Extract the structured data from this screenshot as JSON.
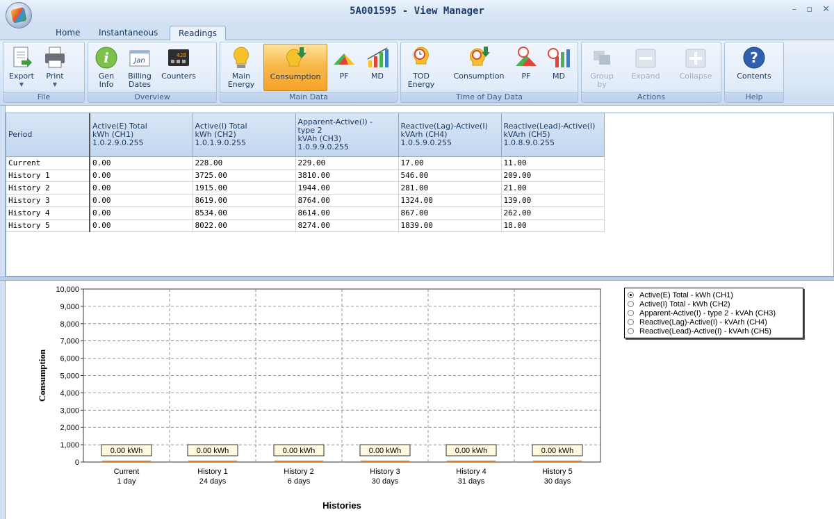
{
  "window": {
    "title": "5A001595 - View Manager",
    "min": "–",
    "max": "▫",
    "close": "✕"
  },
  "tabs": [
    {
      "label": "Home"
    },
    {
      "label": "Instantaneous"
    },
    {
      "label": "Readings"
    }
  ],
  "ribbon": {
    "file": {
      "label": "File",
      "export": "Export",
      "print": "Print"
    },
    "overview": {
      "label": "Overview",
      "gen": "Gen\nInfo",
      "billing": "Billing\nDates",
      "counters": "Counters",
      "billing_icon_text": "Jan",
      "counters_icon_text": "428"
    },
    "main_data": {
      "label": "Main Data",
      "energy": "Main\nEnergy",
      "consumption": "Consumption",
      "pf": "PF",
      "md": "MD"
    },
    "tod": {
      "label": "Time of Day Data",
      "energy": "TOD\nEnergy",
      "consumption": "Consumption",
      "pf": "PF",
      "md": "MD"
    },
    "actions": {
      "label": "Actions",
      "group": "Group\nby",
      "expand": "Expand",
      "collapse": "Collapse"
    },
    "help": {
      "label": "Help",
      "contents": "Contents"
    }
  },
  "table": {
    "headers": [
      "Period",
      "Active(E) Total\nkWh (CH1)\n1.0.2.9.0.255",
      "Active(I) Total\nkWh (CH2)\n1.0.1.9.0.255",
      "Apparent-Active(I) -\ntype 2\nkVAh (CH3)\n1.0.9.9.0.255",
      "Reactive(Lag)-Active(I)\nkVArh (CH4)\n1.0.5.9.0.255",
      "Reactive(Lead)-Active(I)\nkVArh (CH5)\n1.0.8.9.0.255"
    ],
    "rows": [
      [
        "Current",
        "0.00",
        "228.00",
        "229.00",
        "17.00",
        "11.00"
      ],
      [
        "History 1",
        "0.00",
        "3725.00",
        "3810.00",
        "546.00",
        "209.00"
      ],
      [
        "History 2",
        "0.00",
        "1915.00",
        "1944.00",
        "281.00",
        "21.00"
      ],
      [
        "History 3",
        "0.00",
        "8619.00",
        "8764.00",
        "1324.00",
        "139.00"
      ],
      [
        "History 4",
        "0.00",
        "8534.00",
        "8614.00",
        "867.00",
        "262.00"
      ],
      [
        "History 5",
        "0.00",
        "8022.00",
        "8274.00",
        "1839.00",
        "18.00"
      ]
    ]
  },
  "legend": [
    {
      "label": "Active(E) Total - kWh (CH1)",
      "selected": true
    },
    {
      "label": "Active(I) Total - kWh (CH2)",
      "selected": false
    },
    {
      "label": "Apparent-Active(I) - type 2 - kVAh (CH3)",
      "selected": false
    },
    {
      "label": "Reactive(Lag)-Active(I) - kVArh (CH4)",
      "selected": false
    },
    {
      "label": "Reactive(Lead)-Active(I) - kVArh (CH5)",
      "selected": false
    }
  ],
  "chart_data": {
    "type": "bar",
    "xlabel": "Histories",
    "ylabel": "Consumption",
    "ylim": [
      0,
      10000
    ],
    "yticks": [
      "0",
      "1,000",
      "2,000",
      "3,000",
      "4,000",
      "5,000",
      "6,000",
      "7,000",
      "8,000",
      "9,000",
      "10,000"
    ],
    "grid": true,
    "categories": [
      "Current",
      "History 1",
      "History 2",
      "History 3",
      "History 4",
      "History 5"
    ],
    "durations": [
      "1 day",
      "24 days",
      "6 days",
      "30 days",
      "31 days",
      "30 days"
    ],
    "values": [
      0,
      0,
      0,
      0,
      0,
      0
    ],
    "data_labels": [
      "0.00 kWh",
      "0.00 kWh",
      "0.00 kWh",
      "0.00 kWh",
      "0.00 kWh",
      "0.00 kWh"
    ],
    "legend_position": "top-right"
  }
}
